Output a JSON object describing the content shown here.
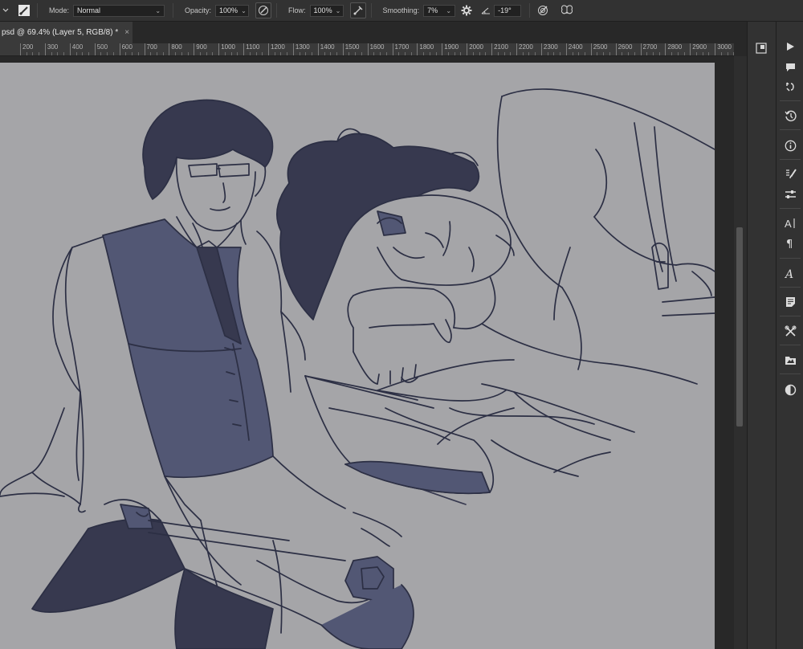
{
  "options_bar": {
    "mode_label": "Mode:",
    "mode_value": "Normal",
    "opacity_label": "Opacity:",
    "opacity_value": "100%",
    "flow_label": "Flow:",
    "flow_value": "100%",
    "smoothing_label": "Smoothing:",
    "smoothing_value": "7%",
    "angle_value": "-19°"
  },
  "document_tab": {
    "title": "psd @ 69.4% (Layer 5, RGB/8) *",
    "close": "×"
  },
  "collapse_glyph": "«",
  "ruler": {
    "ticks": [
      "200",
      "300",
      "400",
      "500",
      "600",
      "700",
      "800",
      "900",
      "1000",
      "1100",
      "1200",
      "1300",
      "1400",
      "1500",
      "1600",
      "1700",
      "1800",
      "1900",
      "2000",
      "2100",
      "2200",
      "2300",
      "2400",
      "2500",
      "2600",
      "2700",
      "2800",
      "2900",
      "3000"
    ]
  },
  "panel_icons": {
    "mid": [
      "navigator-icon"
    ],
    "right": [
      "play-icon",
      "comment-icon",
      "history-brush-icon",
      "history-icon",
      "info-icon",
      "brush-settings-icon",
      "adjustments-icon",
      "character-icon",
      "paragraph-icon",
      "glyphs-icon",
      "notes-icon",
      "tool-presets-icon",
      "layer-comps-icon",
      "color-circle-icon"
    ]
  },
  "colors": {
    "canvas_bg": "#a5a5a8",
    "ink": "#2c2f44",
    "shade": "#525774",
    "dark": "#37394f"
  }
}
